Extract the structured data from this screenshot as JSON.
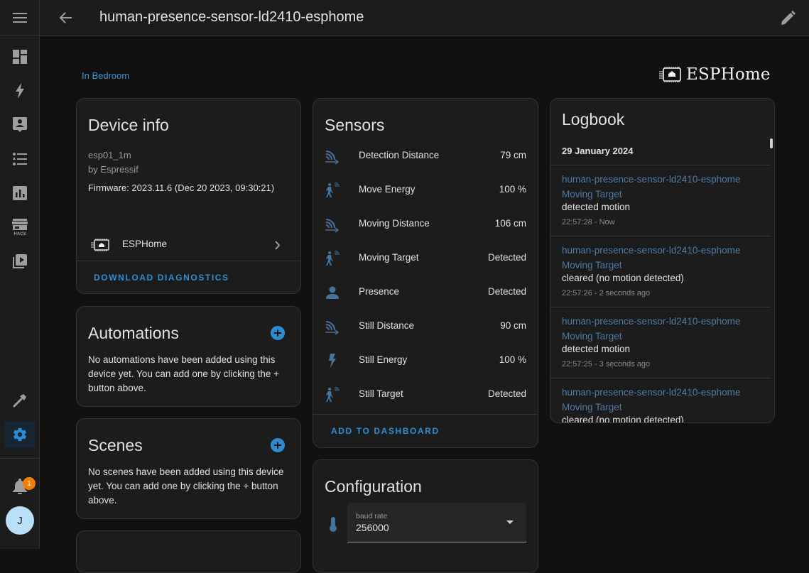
{
  "header": {
    "title": "human-presence-sensor-ld2410-esphome",
    "back_icon": "arrow-left-icon",
    "edit_icon": "pencil-icon"
  },
  "sidebar": {
    "menu_icon": "hamburger-menu-icon",
    "items": [
      {
        "name": "overview",
        "icon": "dashboard-icon"
      },
      {
        "name": "energy",
        "icon": "lightning-bolt-icon"
      },
      {
        "name": "map-person",
        "icon": "account-box-icon"
      },
      {
        "name": "logbook",
        "icon": "format-list-bulleted-icon"
      },
      {
        "name": "history",
        "icon": "chart-box-icon"
      },
      {
        "name": "hacs",
        "icon": "hacs-store-icon",
        "label": "HACS"
      },
      {
        "name": "media",
        "icon": "play-box-multiple-icon"
      },
      {
        "name": "developer-tools",
        "icon": "hammer-icon"
      },
      {
        "name": "settings",
        "icon": "cog-icon",
        "active": true
      }
    ],
    "notifications": {
      "icon": "bell-icon",
      "count": "1"
    },
    "user": {
      "initial": "J"
    }
  },
  "area": {
    "label": "In Bedroom"
  },
  "brand": {
    "name": "ESPHome"
  },
  "device_info": {
    "title": "Device info",
    "model": "esp01_1m",
    "manufacturer": "by Espressif",
    "firmware": "Firmware: 2023.11.6 (Dec 20 2023, 09:30:21)",
    "integration": "ESPHome",
    "download_label": "DOWNLOAD DIAGNOSTICS"
  },
  "automations": {
    "title": "Automations",
    "empty_text": "No automations have been added using this device yet. You can add one by clicking the + button above."
  },
  "scenes": {
    "title": "Scenes",
    "empty_text": "No scenes have been added using this device yet. You can add one by clicking the + button above."
  },
  "sensors": {
    "title": "Sensors",
    "items": [
      {
        "name": "Detection Distance",
        "value": "79 cm",
        "icon": "signal-distance-variant-icon"
      },
      {
        "name": "Move Energy",
        "value": "100 %",
        "icon": "motion-sensor-icon"
      },
      {
        "name": "Moving Distance",
        "value": "106 cm",
        "icon": "signal-distance-variant-icon"
      },
      {
        "name": "Moving Target",
        "value": "Detected",
        "icon": "motion-sensor-icon"
      },
      {
        "name": "Presence",
        "value": "Detected",
        "icon": "account-icon"
      },
      {
        "name": "Still Distance",
        "value": "90 cm",
        "icon": "signal-distance-variant-icon"
      },
      {
        "name": "Still Energy",
        "value": "100 %",
        "icon": "flash-icon"
      },
      {
        "name": "Still Target",
        "value": "Detected",
        "icon": "motion-sensor-icon"
      }
    ],
    "add_label": "ADD TO DASHBOARD"
  },
  "configuration": {
    "title": "Configuration",
    "field_label": "baud rate",
    "field_value": "256000",
    "icon": "thermometer-icon"
  },
  "logbook": {
    "title": "Logbook",
    "date": "29 January 2024",
    "entries": [
      {
        "device": "human-presence-sensor-ld2410-esphome",
        "entity": "Moving Target",
        "message": "detected motion",
        "time": "22:57:28 - Now"
      },
      {
        "device": "human-presence-sensor-ld2410-esphome",
        "entity": "Moving Target",
        "message": "cleared (no motion detected)",
        "time": "22:57:26 - 2 seconds ago"
      },
      {
        "device": "human-presence-sensor-ld2410-esphome",
        "entity": "Moving Target",
        "message": "detected motion",
        "time": "22:57:25 - 3 seconds ago"
      },
      {
        "device": "human-presence-sensor-ld2410-esphome",
        "entity": "Moving Target",
        "message": "cleared (no motion detected)",
        "time": ""
      }
    ]
  },
  "colors": {
    "accent": "#2a8ed6",
    "link": "#3a95d9",
    "icon_blue": "#44739e",
    "badge": "#f57c00",
    "avatar": "#b8e0f9"
  }
}
